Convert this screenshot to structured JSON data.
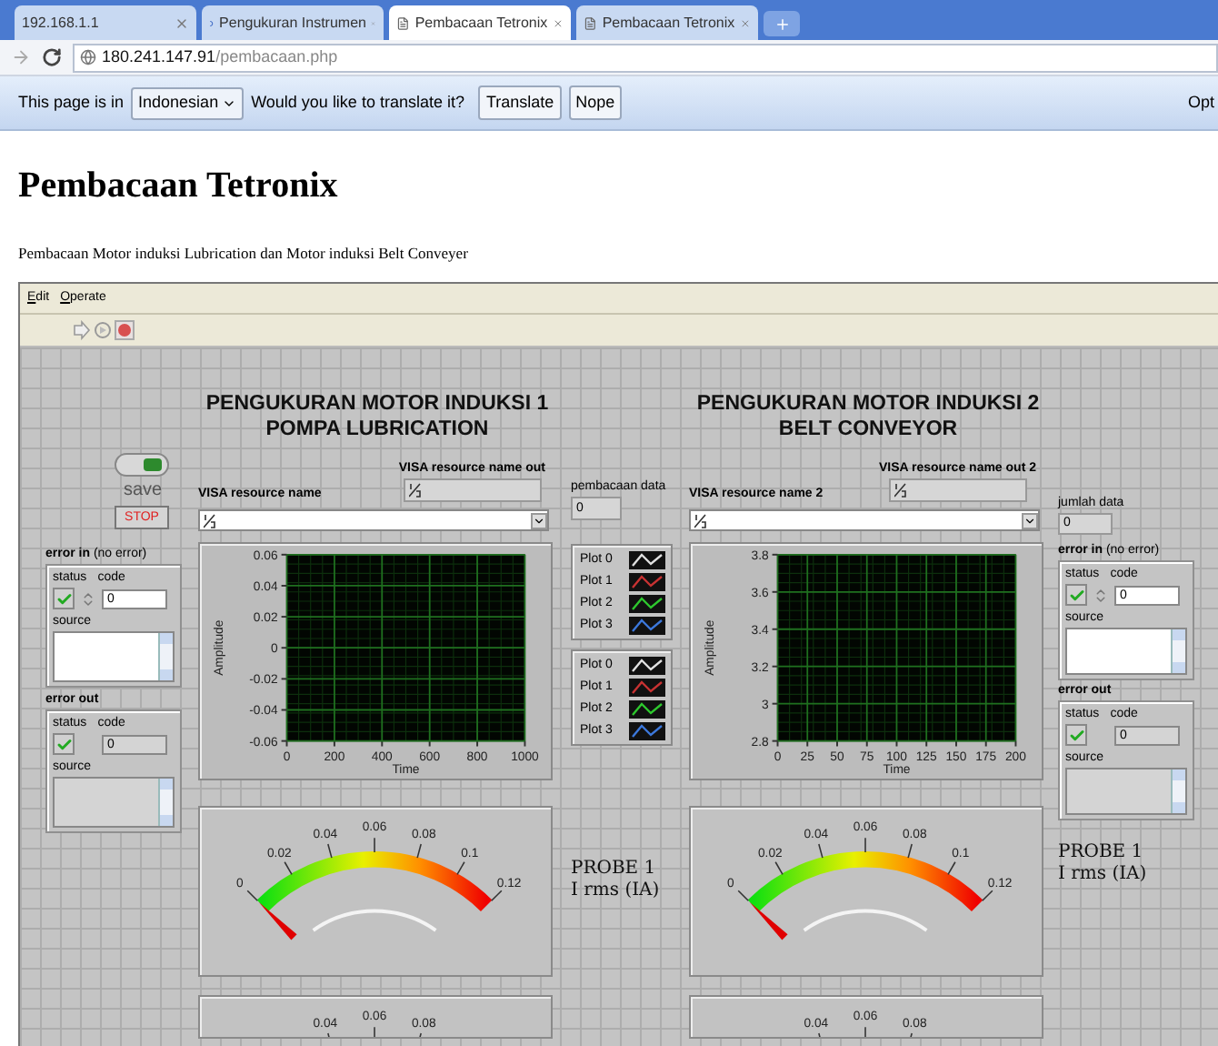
{
  "browser": {
    "tabs": [
      {
        "title": "192.168.1.1",
        "selected": false
      },
      {
        "title": "Pengukuran Instrumen",
        "selected": false,
        "kind": "loading"
      },
      {
        "title": "Pembacaan Tetronix",
        "selected": true,
        "kind": "page"
      },
      {
        "title": "Pembacaan Tetronix",
        "selected": false,
        "kind": "page"
      }
    ],
    "address": {
      "host": "180.241.147.91",
      "path": "/pembacaan.php"
    },
    "translate_bar": {
      "prefix": "This page is in",
      "language": "Indonesian",
      "question": "Would you like to translate it?",
      "buttons": [
        "Translate",
        "Nope"
      ],
      "options": "Opt"
    }
  },
  "page": {
    "heading": "Pembacaan Tetronix",
    "description": "Pembacaan Motor induksi Lubrication dan Motor induksi Belt Conveyer"
  },
  "labview": {
    "menu": [
      "Edit",
      "Operate"
    ],
    "left": {
      "save": {
        "label": "save",
        "on": true
      },
      "stop": "STOP",
      "error_in": {
        "title": "error in",
        "note": "(no error)",
        "status_label": "status",
        "code_label": "code",
        "source_label": "source",
        "code": "0",
        "error": false,
        "kind": "control"
      },
      "error_out": {
        "title": "error out",
        "status_label": "status",
        "code_label": "code",
        "source_label": "source",
        "code": "0",
        "error": false,
        "kind": "indicator"
      }
    },
    "motors": [
      {
        "title_lines": [
          "PENGUKURAN MOTOR INDUKSI 1",
          "POMPA LUBRICATION"
        ],
        "visa_label": "VISA resource name",
        "visa_out_label": "VISA resource name out",
        "chart_data": {
          "type": "line",
          "xlabel": "Time",
          "ylabel": "Amplitude",
          "xlim": [
            0,
            1000
          ],
          "ylim": [
            -0.06,
            0.06
          ],
          "grid": true,
          "xticks": [
            0,
            200,
            400,
            600,
            800,
            1000
          ],
          "yticks": [
            -0.06,
            -0.04,
            -0.02,
            0,
            0.02,
            0.04,
            0.06
          ]
        },
        "gauges": [
          {
            "ticks": [
              "0",
              "0.02",
              "0.04",
              "0.06",
              "0.08",
              "0.1",
              "0.12"
            ],
            "probe": [
              "PROBE 1",
              "I rms (IA)"
            ]
          },
          {
            "ticks": [
              "0.04",
              "0.06",
              "0.08"
            ]
          }
        ]
      },
      {
        "title_lines": [
          "PENGUKURAN MOTOR INDUKSI 2",
          "BELT CONVEYOR"
        ],
        "visa_label": "VISA resource name 2",
        "visa_out_label": "VISA resource name out 2",
        "chart_data": {
          "type": "line",
          "xlabel": "Time",
          "ylabel": "Amplitude",
          "xlim": [
            0,
            200
          ],
          "ylim": [
            2.8,
            3.8
          ],
          "grid": true,
          "xticks": [
            0,
            25,
            50,
            75,
            100,
            125,
            150,
            175,
            200
          ],
          "yticks": [
            2.8,
            3,
            3.2,
            3.4,
            3.6,
            3.8
          ]
        },
        "gauges": [
          {
            "ticks": [
              "0",
              "0.02",
              "0.04",
              "0.06",
              "0.08",
              "0.1",
              "0.12"
            ],
            "probe": [
              "PROBE 1",
              "I rms (IA)"
            ]
          },
          {
            "ticks": [
              "0.04",
              "0.06",
              "0.08"
            ]
          }
        ]
      }
    ],
    "center": {
      "label": "pembacaan data",
      "value": "0",
      "legends": [
        [
          {
            "label": "Plot 0",
            "color": "#e0e0e0"
          },
          {
            "label": "Plot 1",
            "color": "#c83232"
          },
          {
            "label": "Plot 2",
            "color": "#2ec82e"
          },
          {
            "label": "Plot 3",
            "color": "#3c78dc"
          }
        ],
        [
          {
            "label": "Plot 0",
            "color": "#e0e0e0"
          },
          {
            "label": "Plot 1",
            "color": "#c83232"
          },
          {
            "label": "Plot 2",
            "color": "#2ec82e"
          },
          {
            "label": "Plot 3",
            "color": "#3c78dc"
          }
        ]
      ]
    },
    "right": {
      "label": "jumlah data",
      "value": "0",
      "error_in": {
        "title": "error in",
        "note": "(no error)",
        "status_label": "status",
        "code_label": "code",
        "source_label": "source",
        "code": "0",
        "error": false,
        "kind": "control"
      },
      "error_out": {
        "title": "error out",
        "status_label": "status",
        "code_label": "code",
        "source_label": "source",
        "code": "0",
        "error": false,
        "kind": "indicator"
      }
    }
  }
}
